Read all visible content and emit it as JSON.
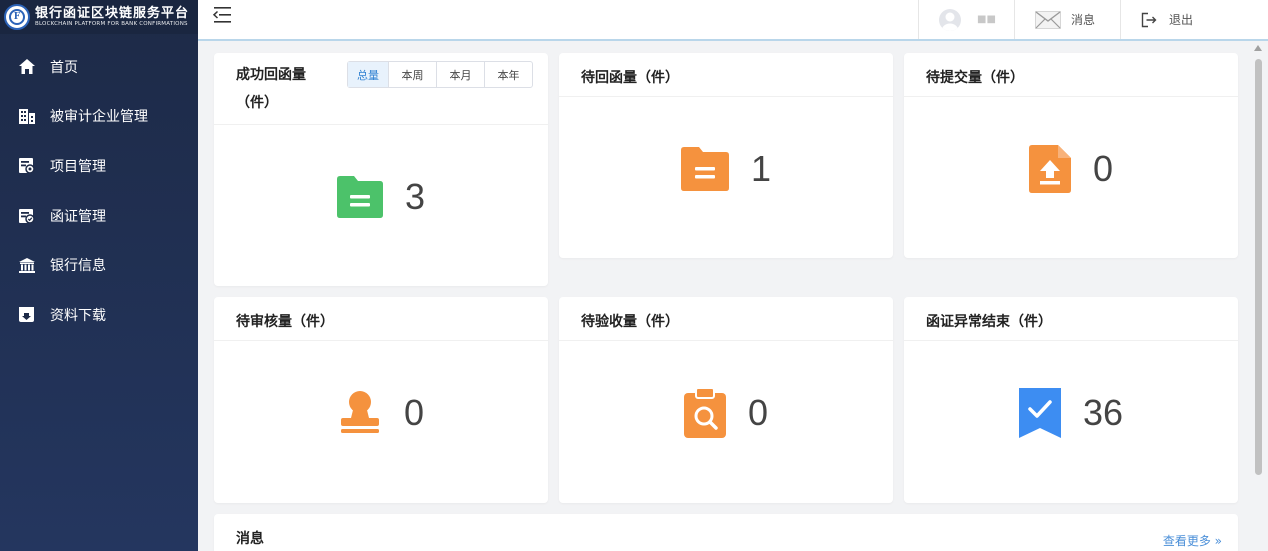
{
  "brand": {
    "title": "银行函证区块链服务平台",
    "subtitle": "BLOCKCHAIN PLATFORM FOR BANK CONFIRMATIONS"
  },
  "sidebar": {
    "items": [
      {
        "label": "首页",
        "icon": "home-icon"
      },
      {
        "label": "被审计企业管理",
        "icon": "building-icon"
      },
      {
        "label": "项目管理",
        "icon": "project-icon"
      },
      {
        "label": "函证管理",
        "icon": "letter-icon"
      },
      {
        "label": "银行信息",
        "icon": "bank-icon"
      },
      {
        "label": "资料下载",
        "icon": "download-icon"
      }
    ]
  },
  "header": {
    "user_name": "■■",
    "messages_label": "消息",
    "logout_label": "退出"
  },
  "cards": {
    "success": {
      "title": "成功回函量（件）",
      "value": "3",
      "tabs": [
        "总量",
        "本周",
        "本月",
        "本年"
      ]
    },
    "pending_reply": {
      "title": "待回函量（件）",
      "value": "1"
    },
    "pending_submit": {
      "title": "待提交量（件）",
      "value": "0"
    },
    "pending_review": {
      "title": "待审核量（件）",
      "value": "0"
    },
    "pending_check": {
      "title": "待验收量（件）",
      "value": "0"
    },
    "abnormal_end": {
      "title": "函证异常结束（件）",
      "value": "36"
    }
  },
  "messages": {
    "title": "消息",
    "more_label": "查看更多 »"
  },
  "colors": {
    "sidebar": "#1d2a47",
    "green": "#4cc26a",
    "orange": "#f5923e",
    "blue": "#3d8df2",
    "link": "#4b8fd8"
  }
}
